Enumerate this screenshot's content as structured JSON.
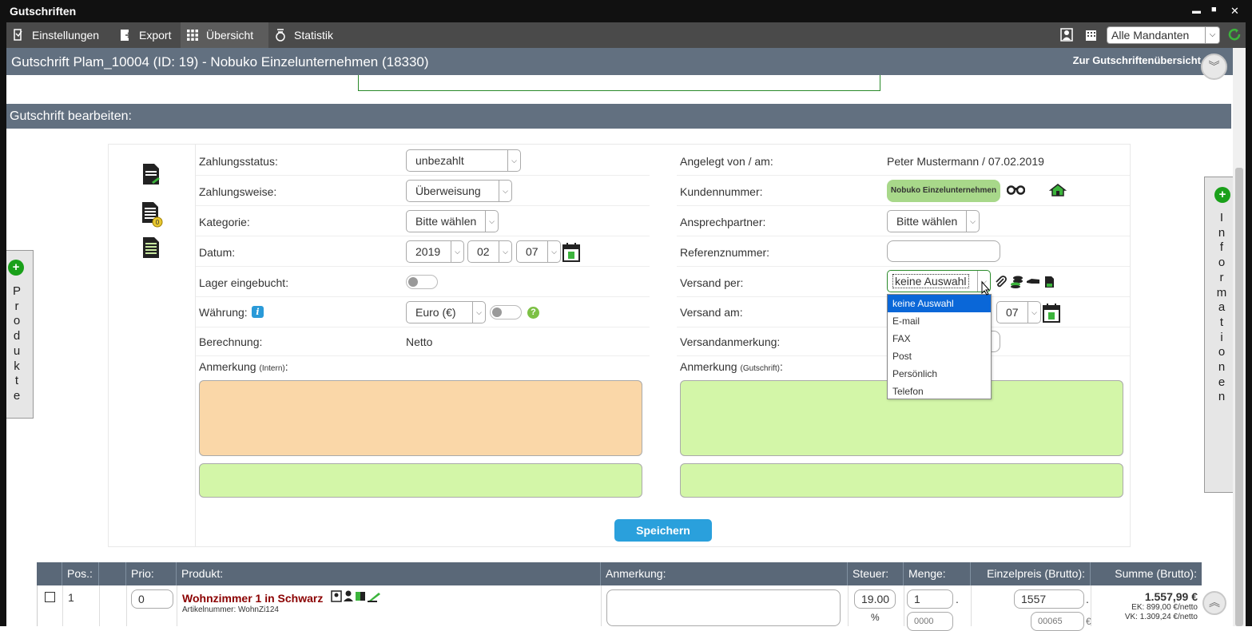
{
  "window": {
    "title": "Gutschriften",
    "minimize": "▬",
    "maximize": "■",
    "close": "✕"
  },
  "menu": {
    "items": [
      "Einstellungen",
      "Export",
      "Übersicht",
      "Statistik"
    ],
    "mandant_select": "Alle Mandanten"
  },
  "header": {
    "title": "Gutschrift Plam_10004 (ID: 19) - Nobuko Einzelunternehmen (18330)",
    "overview_link": "Zur Gutschriftenübersicht"
  },
  "section": {
    "title": "Gutschrift bearbeiten:"
  },
  "left": {
    "zahlungsstatus_label": "Zahlungsstatus:",
    "zahlungsstatus_value": "unbezahlt",
    "zahlungsweise_label": "Zahlungsweise:",
    "zahlungsweise_value": "Überweisung",
    "kategorie_label": "Kategorie:",
    "kategorie_value": "Bitte wählen",
    "datum_label": "Datum:",
    "datum_year": "2019",
    "datum_month": "02",
    "datum_day": "07",
    "lager_label": "Lager eingebucht:",
    "waehrung_label": "Währung:",
    "waehrung_value": "Euro (€)",
    "berechnung_label": "Berechnung:",
    "berechnung_value": "Netto",
    "anmerkung_label": "Anmerkung",
    "anmerkung_sub": "(Intern)",
    "anmerkung_colon": ":"
  },
  "right": {
    "angelegt_label": "Angelegt von / am:",
    "angelegt_value": "Peter Mustermann / 07.02.2019",
    "kundennummer_label": "Kundennummer:",
    "kunde_badge": "Nobuko Einzelunternehmen",
    "ansprechpartner_label": "Ansprechpartner:",
    "ansprechpartner_value": "Bitte wählen",
    "referenz_label": "Referenznummer:",
    "versand_label": "Versand per:",
    "versand_value": "keine Auswahl",
    "versand_am_label": "Versand am:",
    "versand_am_day": "07",
    "versandanmerkung_label": "Versandanmerkung:",
    "anmerkung_label": "Anmerkung",
    "anmerkung_sub": "(Gutschrift)",
    "anmerkung_colon": ":"
  },
  "dropdown_options": [
    "keine Auswahl",
    "E-mail",
    "FAX",
    "Post",
    "Persönlich",
    "Telefon"
  ],
  "save_button": "Speichern",
  "side_tabs": {
    "left": "Produkte",
    "right": "Informationen"
  },
  "table": {
    "headers": [
      "Pos.:",
      "Prio:",
      "Produkt:",
      "Anmerkung:",
      "Steuer:",
      "Menge:",
      "Einzelpreis (Brutto):",
      "Summe (Brutto):"
    ],
    "row": {
      "pos": "1",
      "prio": "0",
      "product": "Wohnzimmer 1 in Schwarz",
      "article_label": "Artikelnummer: WohnZi124",
      "tax": "19.00",
      "tax_unit": "%",
      "qty": "1",
      "qty_dot": ".",
      "qty_sub": "0000",
      "price": "1557",
      "price_dot": ".",
      "price_sub": "00065",
      "price_unit": "€",
      "sum": "1.557,99 €",
      "ek": "EK: 899,00 €/netto",
      "vk": "VK: 1.309,24 €/netto"
    }
  }
}
